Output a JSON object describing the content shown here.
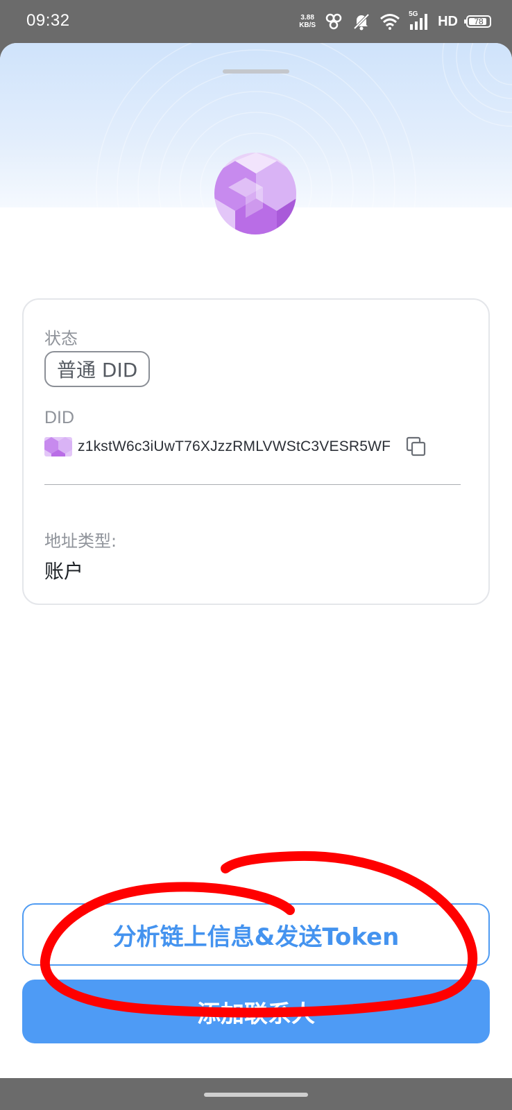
{
  "status_bar": {
    "time": "09:32",
    "net_speed_value": "3.88",
    "net_speed_unit": "KB/S",
    "signal_label": "5G",
    "hd_label": "HD",
    "battery_percent": "78"
  },
  "card": {
    "status_label": "状态",
    "status_badge": "普通 DID",
    "did_label": "DID",
    "did_value": "z1kstW6c3iUwT76XJzzRMLVWStC3VESR5WF",
    "address_type_label": "地址类型:",
    "address_type_value": "账户"
  },
  "buttons": {
    "analyze_send_label": "分析链上信息&发送Token",
    "add_contact_label": "添加联系人"
  },
  "colors": {
    "accent": "#4e9bf5",
    "annotation": "#ff0000",
    "avatar_primary": "#b76ee6"
  },
  "icons": [
    "network-icon",
    "mute-icon",
    "wifi-icon",
    "cellular-icon",
    "battery-icon",
    "copy-icon"
  ]
}
